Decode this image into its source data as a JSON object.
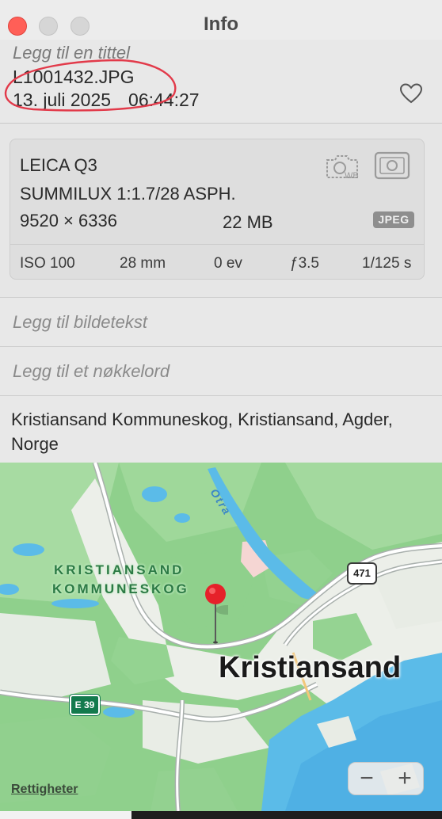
{
  "window": {
    "title": "Info"
  },
  "photo": {
    "title_placeholder": "Legg til en tittel",
    "filename": "L1001432.JPG",
    "date": "13. juli 2025",
    "time": "06:44:27"
  },
  "camera": {
    "model": "LEICA Q3",
    "lens": "SUMMILUX 1:1.7/28 ASPH.",
    "resolution": "9520 × 6336",
    "file_size": "22 MB",
    "format": "JPEG",
    "exif": {
      "iso": "ISO 100",
      "focal_length": "28 mm",
      "exposure_bias": "0 ev",
      "aperture": "ƒ3.5",
      "shutter": "1/125 s"
    }
  },
  "fields": {
    "caption_placeholder": "Legg til bildetekst",
    "keyword_placeholder": "Legg til et nøkkelord"
  },
  "location": {
    "text": "Kristiansand Kommuneskog, Kristiansand, Agder, Norge"
  },
  "map": {
    "park_label_line1": "KRISTIANSAND",
    "park_label_line2": "KOMMUNESKOG",
    "city_label": "Kristiansand",
    "river_label": "Otra",
    "road_shield_1": "471",
    "road_shield_2": "E 39",
    "rights_link": "Rettigheter",
    "zoom_out": "−",
    "zoom_in": "+"
  },
  "colors": {
    "close_button": "#ff5f57",
    "map_forest": "#8fd08c",
    "map_water": "#5bbbe8",
    "pin": "#e6212a",
    "annotation_circle": "#e23a4a"
  },
  "icons": {
    "favorite": "heart-icon",
    "white_balance": "camera-wb-icon",
    "metering": "metering-icon",
    "map_pin": "map-pin-icon"
  }
}
